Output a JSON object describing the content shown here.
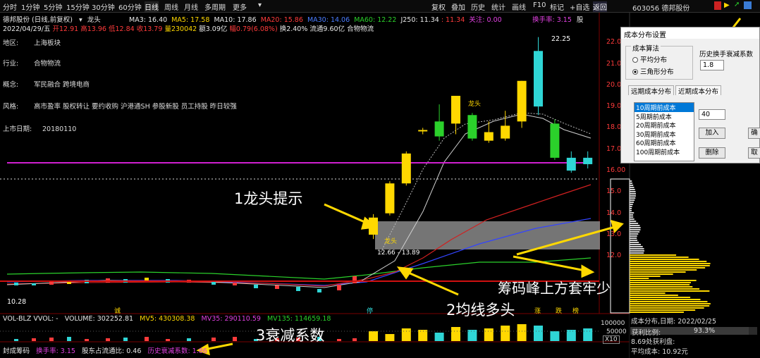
{
  "toolbar": {
    "items": [
      "分时",
      "1分钟",
      "5分钟",
      "15分钟",
      "30分钟",
      "60分钟",
      "日线",
      "周线",
      "月线",
      "多周期",
      "更多"
    ],
    "right_items": [
      "复权",
      "叠加",
      "历史",
      "统计",
      "画线",
      "F10",
      "标记",
      "+自选",
      "返回"
    ]
  },
  "stock": {
    "title": "德邦股份 (日线,前复权)",
    "tag": "龙头",
    "ma": {
      "MA3": "MA3: 16.40",
      "MA5": "MA5: 17.58",
      "MA10": "MA10: 17.86",
      "MA20": "MA20: 15.86",
      "MA30": "MA30: 14.06",
      "MA60": "MA60: 12.22",
      "J250": "J250: 11.34",
      "x": ": 11.34"
    },
    "focus": "关注: 0.00",
    "turn": "换手率: 3.15",
    "code_header": "603056 德邦股份",
    "date_line": "2022/04/29/五",
    "open": "开12.91",
    "high": "高13.96",
    "low": "低12.84",
    "close": "收13.79",
    "vol": "量230042",
    "amt": "额3.09亿",
    "pct": "幅0.79(6.08%)",
    "turnover": "换2.40%",
    "float": "流通9.60亿",
    "sector": "合物物流"
  },
  "fin": [
    {
      "label": "地区:",
      "value": "上海板块"
    },
    {
      "label": "行业:",
      "value": "合物物流"
    },
    {
      "label": "概念:",
      "value": "军民融合 跨境电商"
    },
    {
      "label": "风格:",
      "value": "高市盈率 股权转让 要约收购 沪港通SH 参股新股 员工持股 昨日较强"
    },
    {
      "label": "上市日期:",
      "value": "20180110"
    }
  ],
  "annotations": {
    "a1": "1龙头提示",
    "a2": "2均线多头",
    "a3": "3衰减系数",
    "a4": "筹码峰上方套牢少",
    "box_label": "龙头",
    "box_range": "12.66 - 13.89",
    "peak_label": "22.25",
    "low_label": "10.28",
    "dragon_small": "龙头",
    "marks": [
      "诚",
      "停",
      "涨",
      "跌",
      "榜"
    ]
  },
  "price_axis": [
    "22.0",
    "21.0",
    "20.0",
    "19.0",
    "18.0",
    "17.0",
    "16.00",
    "15.0",
    "14.0",
    "13.0",
    "12.0"
  ],
  "vol_axis": [
    "100000",
    "50000",
    "X10"
  ],
  "volume_panel": {
    "title": "VOL-BLZ VVOL: -",
    "volume": "VOLUME: 302252.81",
    "mv5": "MV5: 430308.38",
    "mv35": "MV35: 290110.59",
    "mv135": "MV135: 114659.18"
  },
  "bottom_panel": {
    "name": "封成筹码",
    "turn": "换手率: 3.15",
    "share": "股东占流通比: 0.46",
    "decay": "历史衰减系数: 1.86"
  },
  "dialog": {
    "title": "成本分布设置",
    "method_group": "成本算法",
    "opt1": "平均分布",
    "opt2": "三角形分布",
    "decay_label": "历史换手衰减系数",
    "decay_value": "1.8",
    "tab1": "远期成本分布",
    "tab2": "近期成本分布",
    "list": [
      "10周期前成本",
      "5周期前成本",
      "20周期前成本",
      "30周期前成本",
      "60周期前成本",
      "100周期前成本"
    ],
    "period_value": "40",
    "add": "加入",
    "delete": "删除",
    "ok": "确",
    "cancel": "取"
  },
  "right_stats": {
    "line1": "成本分布,日期: 2022/02/25",
    "ratio_label": "获利比例:",
    "ratio_value": "93.3%",
    "ratio": 0.933,
    "line3": "8.69处获利盘:",
    "line4": "平均成本: 10.92元"
  },
  "colors": {
    "up": "#ff3b3b",
    "down": "#2bd12b",
    "yellow": "#ffd800",
    "cyan": "#2fd6d6",
    "magenta": "#e040e0"
  },
  "chart_data": {
    "type": "candlestick",
    "price_range": [
      9.8,
      22.6
    ],
    "candles": [
      {
        "o": 13.0,
        "c": 13.8,
        "h": 13.96,
        "l": 12.8,
        "up": true
      },
      {
        "o": 14.0,
        "c": 15.4,
        "h": 15.5,
        "l": 13.9,
        "up": true
      },
      {
        "o": 15.4,
        "c": 16.8,
        "h": 16.9,
        "l": 15.3,
        "up": true
      },
      {
        "o": 17.9,
        "c": 17.9,
        "h": 18.0,
        "l": 17.7,
        "up": true
      },
      {
        "o": 17.6,
        "c": 18.3,
        "h": 19.1,
        "l": 17.4,
        "up": false
      },
      {
        "o": 18.2,
        "c": 19.5,
        "h": 19.5,
        "l": 17.7,
        "up": true
      },
      {
        "o": 18.6,
        "c": 17.5,
        "h": 18.7,
        "l": 17.4,
        "up": false
      },
      {
        "o": 17.4,
        "c": 17.8,
        "h": 18.3,
        "l": 17.3,
        "up": true
      },
      {
        "o": 17.5,
        "c": 18.1,
        "h": 18.8,
        "l": 17.4,
        "up": true
      },
      {
        "o": 18.3,
        "c": 20.2,
        "h": 20.2,
        "l": 18.0,
        "up": true
      },
      {
        "o": 19.0,
        "c": 21.6,
        "h": 22.25,
        "l": 18.6,
        "up": false
      },
      {
        "o": 18.2,
        "c": 16.6,
        "h": 18.4,
        "l": 16.5,
        "up": false
      },
      {
        "o": 16.6,
        "c": 16.0,
        "h": 16.9,
        "l": 15.9,
        "up": false
      },
      {
        "o": 16.3,
        "c": 16.6,
        "h": 16.9,
        "l": 16.1,
        "up": false
      }
    ],
    "hline_price": 16.5,
    "dashed_price": 15.9
  }
}
